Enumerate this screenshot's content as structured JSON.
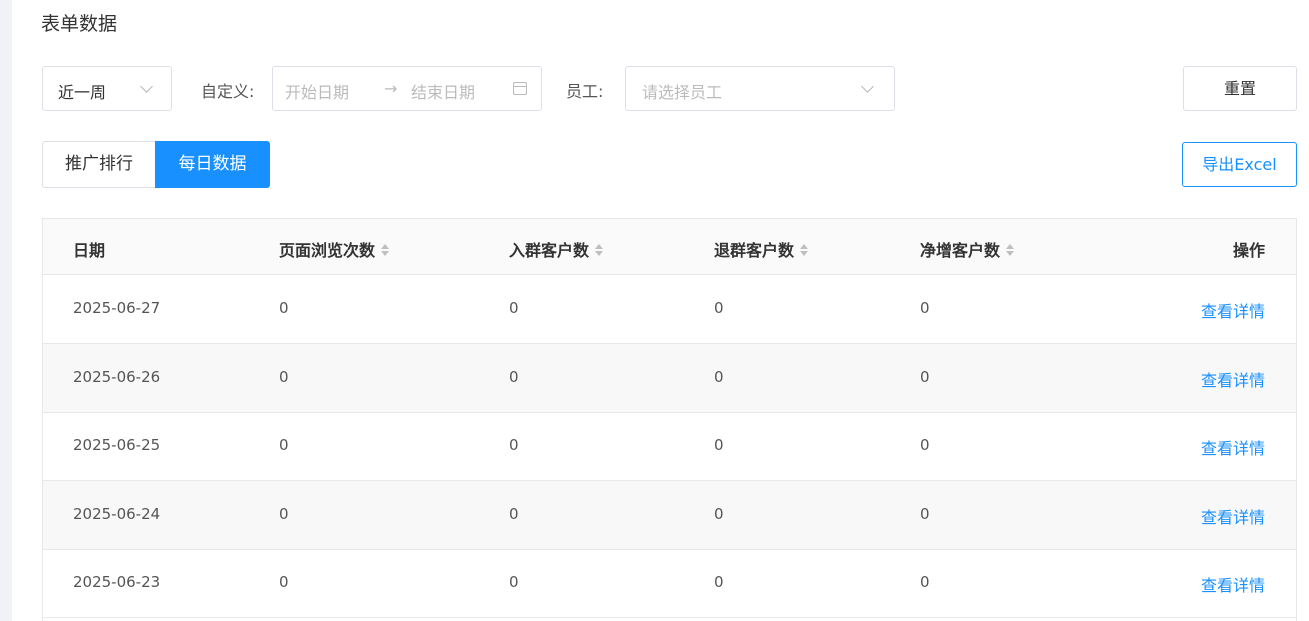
{
  "page_title": "表单数据",
  "filters": {
    "period_value": "近一周",
    "custom_label": "自定义:",
    "start_placeholder": "开始日期",
    "range_arrow": "→",
    "end_placeholder": "结束日期",
    "employee_label": "员工:",
    "employee_placeholder": "请选择员工",
    "reset_label": "重置"
  },
  "tabs": [
    {
      "label": "推广排行",
      "active": false
    },
    {
      "label": "每日数据",
      "active": true
    }
  ],
  "export_label": "导出Excel",
  "table": {
    "columns": [
      "日期",
      "页面浏览次数",
      "入群客户数",
      "退群客户数",
      "净增客户数",
      "操作"
    ],
    "rows": [
      {
        "date": "2025-06-27",
        "views": "0",
        "joined": "0",
        "left": "0",
        "net": "0",
        "action": "查看详情"
      },
      {
        "date": "2025-06-26",
        "views": "0",
        "joined": "0",
        "left": "0",
        "net": "0",
        "action": "查看详情"
      },
      {
        "date": "2025-06-25",
        "views": "0",
        "joined": "0",
        "left": "0",
        "net": "0",
        "action": "查看详情"
      },
      {
        "date": "2025-06-24",
        "views": "0",
        "joined": "0",
        "left": "0",
        "net": "0",
        "action": "查看详情"
      },
      {
        "date": "2025-06-23",
        "views": "0",
        "joined": "0",
        "left": "0",
        "net": "0",
        "action": "查看详情"
      }
    ]
  },
  "colors": {
    "primary": "#1890ff",
    "border": "#dcdfe6",
    "header_bg": "#fafafa",
    "page_bg": "#f0f2f5"
  }
}
